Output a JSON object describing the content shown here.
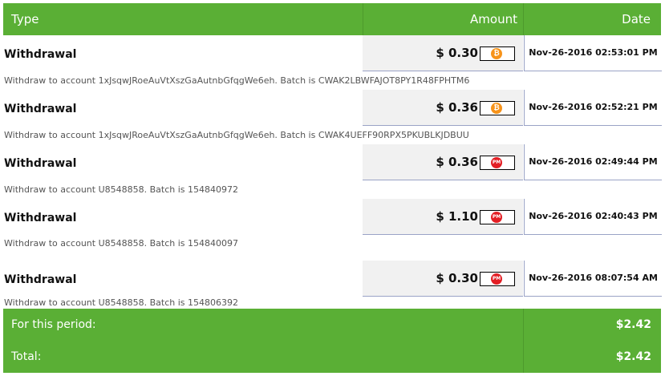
{
  "table": {
    "headers": {
      "type": "Type",
      "amount": "Amount",
      "date": "Date"
    },
    "rows": [
      {
        "type": "Withdrawal",
        "amount": "$ 0.30",
        "currency_icon": "bitcoin-icon",
        "date": "Nov-26-2016 02:53:01 PM",
        "note": "Withdraw to account 1xJsqwJRoeAuVtXszGaAutnbGfqgWe6eh. Batch is CWAK2LBWFAJOT8PY1R48FPHTM6"
      },
      {
        "type": "Withdrawal",
        "amount": "$ 0.36",
        "currency_icon": "bitcoin-icon",
        "date": "Nov-26-2016 02:52:21 PM",
        "note": "Withdraw to account 1xJsqwJRoeAuVtXszGaAutnbGfqgWe6eh. Batch is CWAK4UEFF90RPX5PKUBLKJDBUU"
      },
      {
        "type": "Withdrawal",
        "amount": "$ 0.36",
        "currency_icon": "perfect-money-icon",
        "date": "Nov-26-2016 02:49:44 PM",
        "note": "Withdraw to account U8548858. Batch is 154840972"
      },
      {
        "type": "Withdrawal",
        "amount": "$ 1.10",
        "currency_icon": "perfect-money-icon",
        "date": "Nov-26-2016 02:40:43 PM",
        "note": "Withdraw to account U8548858. Batch is 154840097"
      },
      {
        "type": "Withdrawal",
        "amount": "$ 0.30",
        "currency_icon": "perfect-money-icon",
        "date": "Nov-26-2016 08:07:54 AM",
        "note": "Withdraw to account U8548858. Batch is 154806392"
      }
    ],
    "footer": {
      "period_label": "For this period:",
      "period_value": "$2.42",
      "total_label": "Total:",
      "total_value": "$2.42"
    }
  },
  "icons": {
    "bitcoin_symbol": "₿",
    "pm_symbol": "PM"
  },
  "colors": {
    "header_bg": "#5aaf35",
    "bitcoin": "#f7931a",
    "perfect_money": "#e31e24"
  }
}
